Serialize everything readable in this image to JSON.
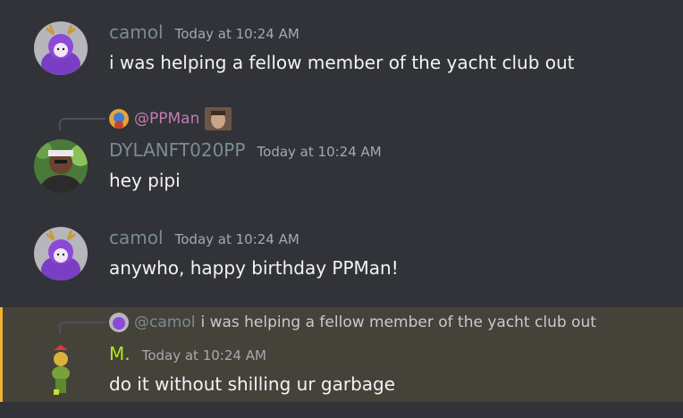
{
  "messages": [
    {
      "username": "camol",
      "username_color": "#7b8c94",
      "timestamp": "Today at 10:24 AM",
      "content": "i was helping a fellow member of the yacht club out"
    },
    {
      "reply_to": {
        "mention": "@PPMan",
        "color": "#c27bb1"
      },
      "username": "DYLANFT020PP",
      "username_color": "#7b8c94",
      "timestamp": "Today at 10:24 AM",
      "content": "hey pipi"
    },
    {
      "username": "camol",
      "username_color": "#7b8c94",
      "timestamp": "Today at 10:24 AM",
      "content": "anywho, happy birthday PPMan!"
    },
    {
      "highlighted": true,
      "reply_to": {
        "mention": "@camol",
        "color": "#7b8c94",
        "text": "i was helping a fellow member of the yacht club out"
      },
      "username": "M.",
      "username_color": "#b5e61d",
      "timestamp": "Today at 10:24 AM",
      "content": "do it without shilling ur garbage"
    }
  ]
}
